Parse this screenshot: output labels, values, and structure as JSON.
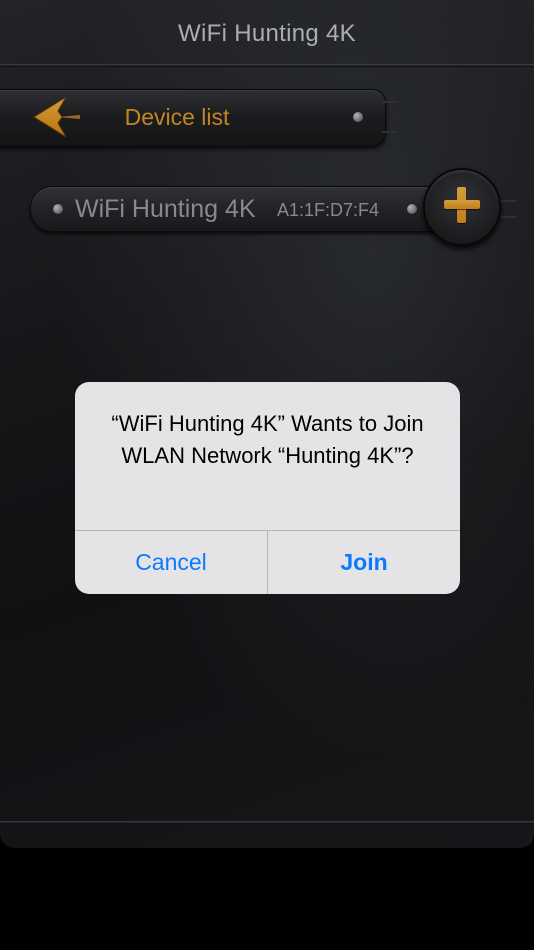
{
  "app": {
    "title": "WiFi Hunting 4K"
  },
  "header": {
    "back_icon": "orange-left-arrow",
    "title": "Device list"
  },
  "devices": [
    {
      "name": "WiFi Hunting 4K",
      "mac": "A1:1F:D7:F4",
      "add_icon": "orange-plus"
    }
  ],
  "alert": {
    "message": "“WiFi Hunting 4K” Wants to Join WLAN Network “Hunting 4K”?",
    "cancel_label": "Cancel",
    "join_label": "Join"
  },
  "colors": {
    "accent_orange": "#F0A12A",
    "ios_blue": "#0A7AFF",
    "alert_bg": "#E4E4E6"
  }
}
